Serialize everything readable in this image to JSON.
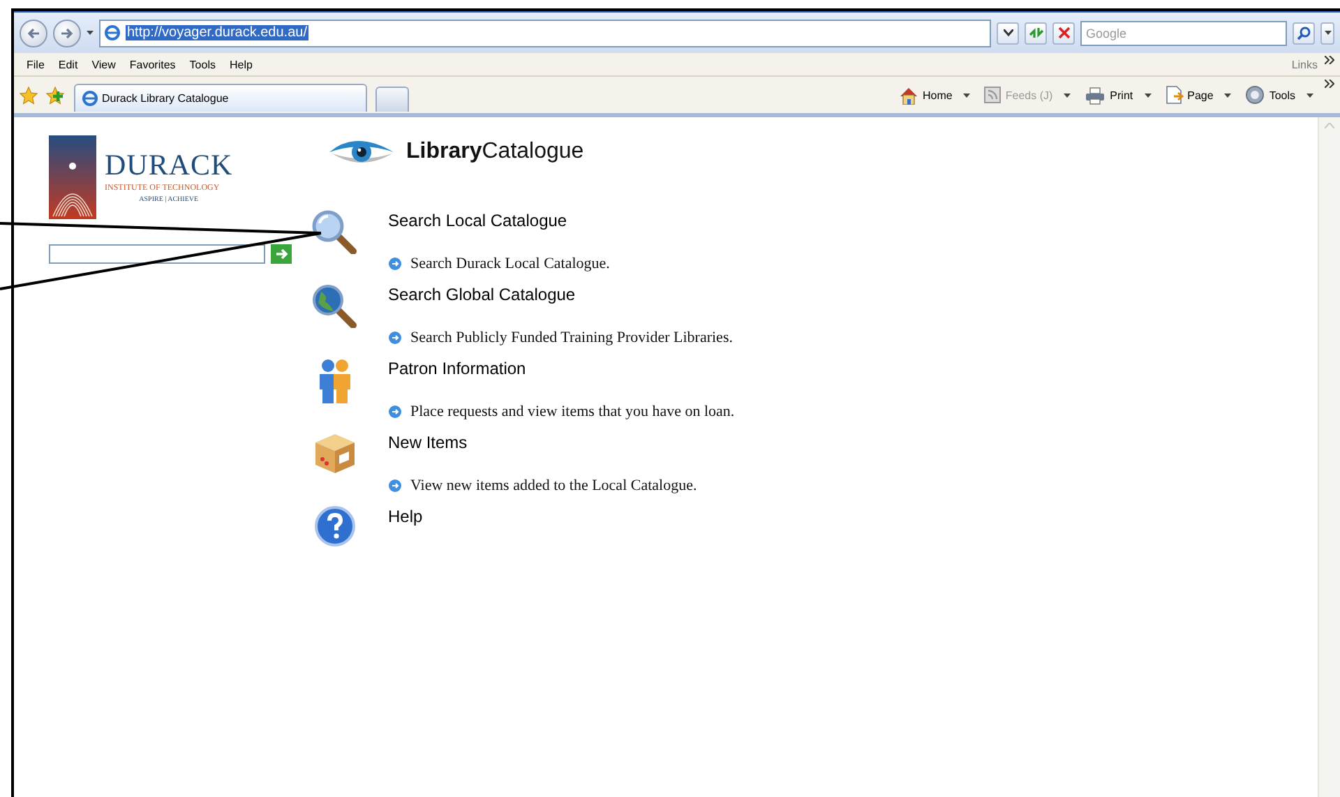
{
  "browser": {
    "address": "http://voyager.durack.edu.au/",
    "search_placeholder": "Google",
    "menu": [
      "File",
      "Edit",
      "View",
      "Favorites",
      "Tools",
      "Help"
    ],
    "links_label": "Links",
    "tab_title": "Durack Library Catalogue",
    "commands": [
      {
        "kind": "home",
        "label": "Home",
        "disabled": false
      },
      {
        "kind": "feeds",
        "label": "Feeds (J)",
        "disabled": true
      },
      {
        "kind": "print",
        "label": "Print",
        "disabled": false
      },
      {
        "kind": "page",
        "label": "Page",
        "disabled": false
      },
      {
        "kind": "tools",
        "label": "Tools",
        "disabled": false
      }
    ]
  },
  "logo": {
    "name": "DURACK",
    "subtitle": "INSTITUTE OF TECHNOLOGY",
    "tagline": "ASPIRE | ACHIEVE"
  },
  "catalogue_logo": "**Library**Catalogue",
  "items": [
    {
      "kind": "search-local",
      "title": "Search Local Catalogue",
      "description": "Search Durack Local Catalogue."
    },
    {
      "kind": "search-global",
      "title": "Search Global Catalogue",
      "description": "Search Publicly Funded Training Provider Libraries."
    },
    {
      "kind": "patron",
      "title": "Patron Information",
      "description": "Place requests and view items that you have on loan."
    },
    {
      "kind": "new-items",
      "title": "New Items",
      "description": "View new items added to the Local Catalogue."
    },
    {
      "kind": "help",
      "title": "Help"
    }
  ]
}
